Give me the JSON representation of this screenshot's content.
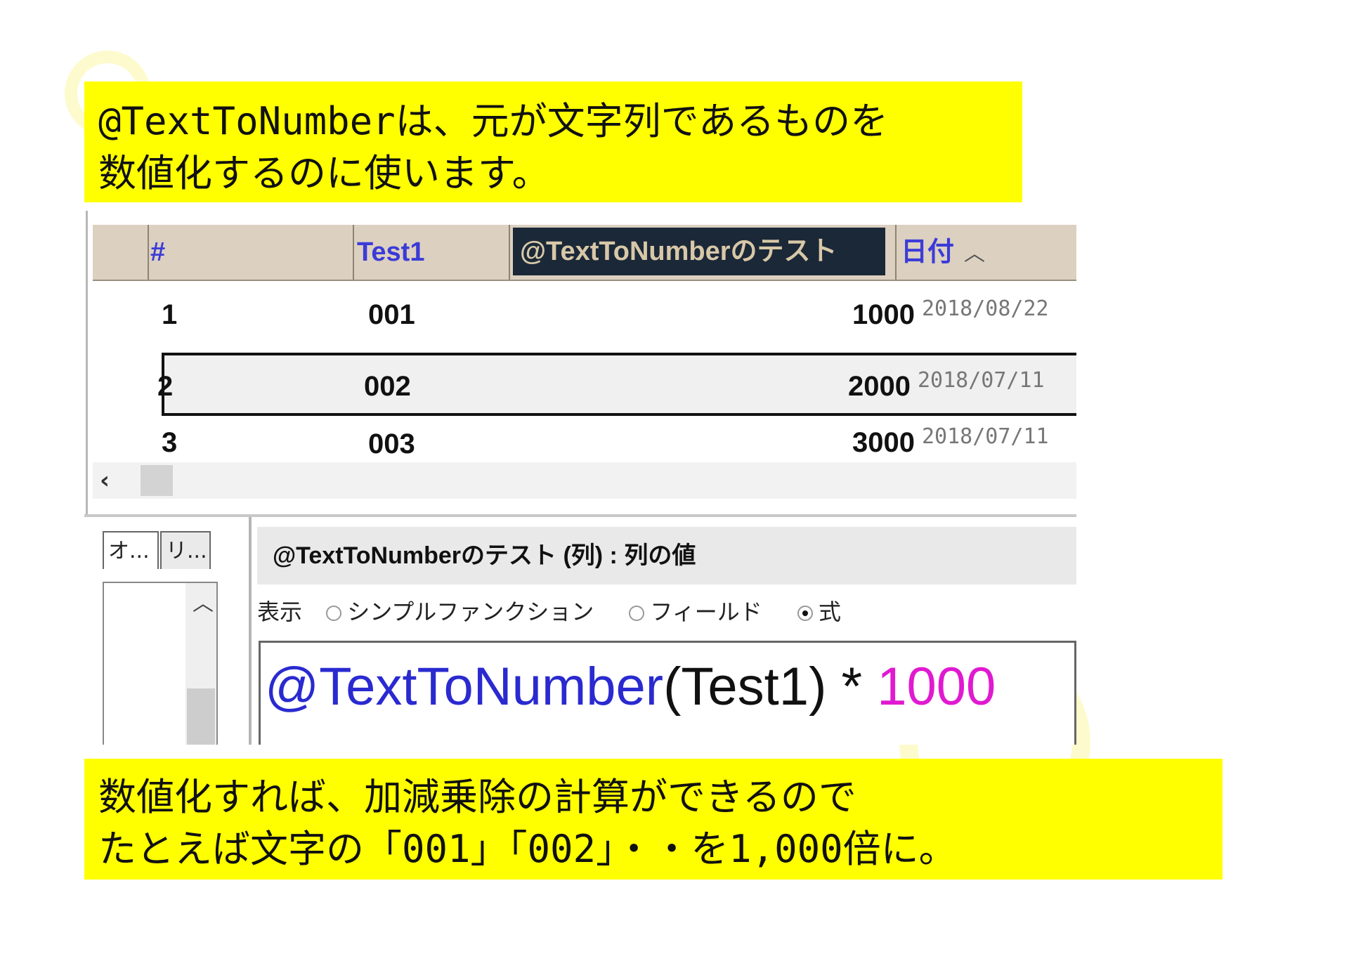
{
  "callouts": {
    "top": [
      "@TextToNumberは、元が文字列であるものを",
      "数値化するのに使います。"
    ],
    "bottom": [
      "数値化すれば、加減乗除の計算ができるので",
      "たとえば文字の「001」「002」・・を1,000倍に。"
    ]
  },
  "grid": {
    "headers": {
      "hash": "#",
      "test1": "Test1",
      "ttn": "@TextToNumberのテスト",
      "date": "日付"
    },
    "rows": [
      {
        "hash": "1",
        "test1": "001",
        "value": "1000",
        "date": "2018/08/22"
      },
      {
        "hash": "2",
        "test1": "002",
        "value": "2000",
        "date": "2018/07/11"
      },
      {
        "hash": "3",
        "test1": "003",
        "value": "3000",
        "date": "2018/07/11"
      }
    ]
  },
  "icons": {
    "sort": "chevron-up-icon",
    "scroll_left": "chevron-left-icon",
    "scroll_up": "chevron-up-icon"
  },
  "left_tabs": [
    "オ...",
    "リ..."
  ],
  "panel": {
    "title": "@TextToNumberのテスト (列) : 列の値",
    "display_label": "表示",
    "options": [
      "シンプルファンクション",
      "フィールド",
      "式"
    ],
    "selected_option": "式",
    "formula": {
      "func": "@TextToNumber",
      "args": "(Test1)",
      "op": " * ",
      "num": "1000"
    }
  },
  "colors": {
    "callout_bg": "#ffff00",
    "header_bg": "#dcd0c0",
    "header_text": "#3b3bd8",
    "formula_func": "#2a2ad0",
    "formula_number": "#e01ad0"
  }
}
